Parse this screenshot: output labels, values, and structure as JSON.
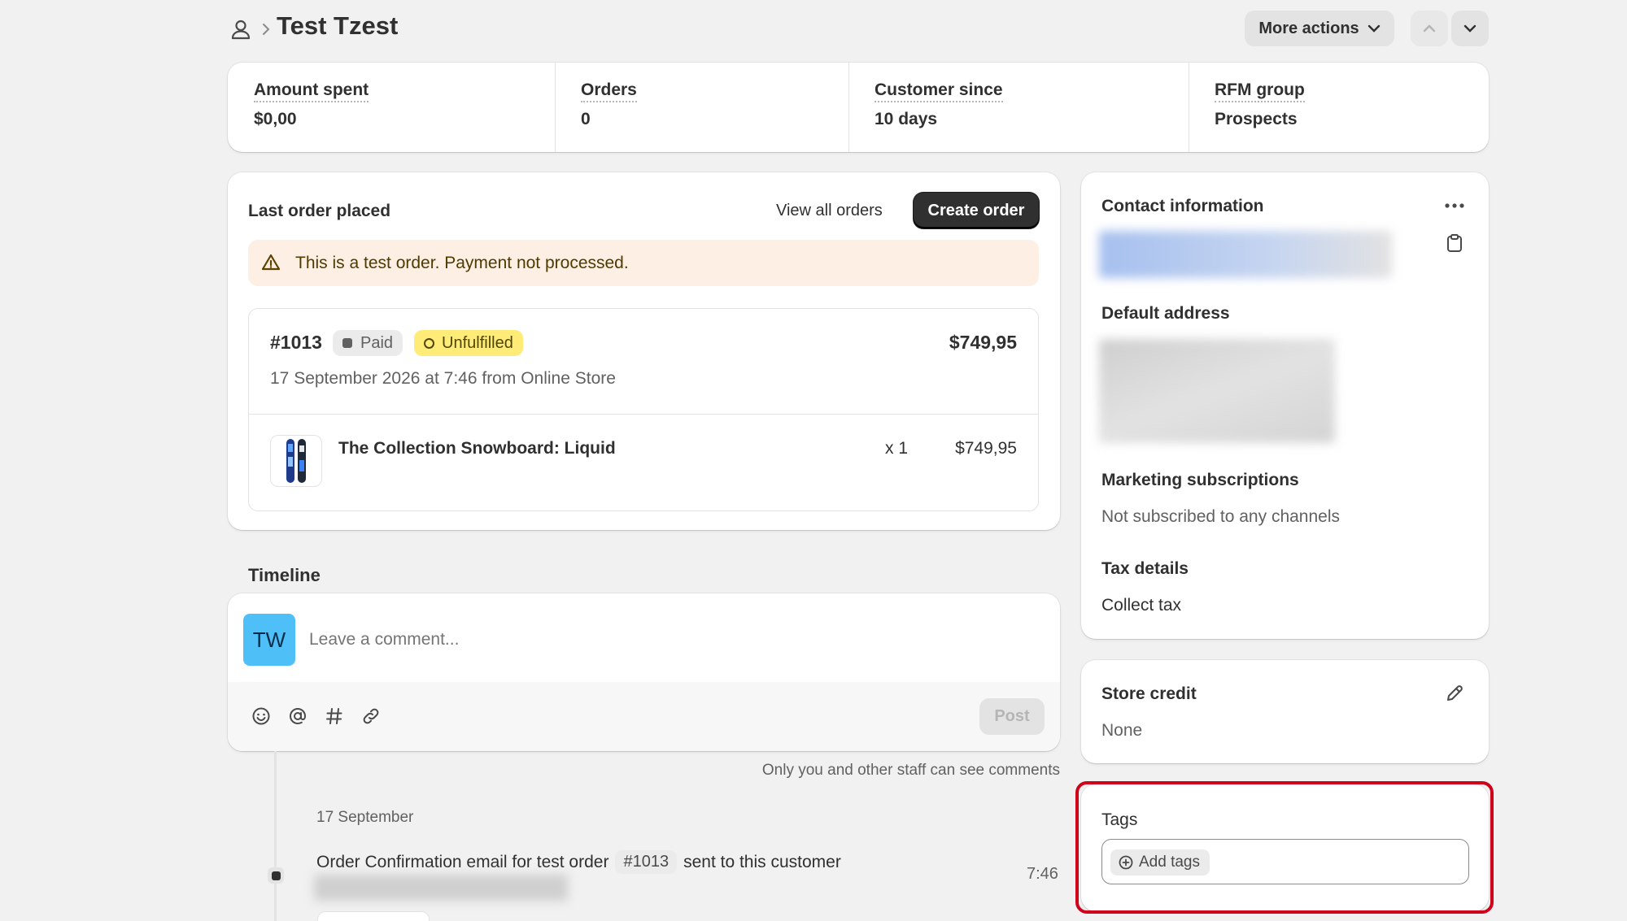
{
  "header": {
    "title": "Test Tzest",
    "more_actions": "More actions"
  },
  "stats": [
    {
      "label": "Amount spent",
      "value": "$0,00"
    },
    {
      "label": "Orders",
      "value": "0"
    },
    {
      "label": "Customer since",
      "value": "10 days"
    },
    {
      "label": "RFM group",
      "value": "Prospects"
    }
  ],
  "last_order": {
    "title": "Last order placed",
    "view_all": "View all orders",
    "create": "Create order",
    "warning": "This is a test order. Payment not processed.",
    "number": "#1013",
    "paid_badge": "Paid",
    "fulfillment_badge": "Unfulfilled",
    "total": "$749,95",
    "meta": "17 September 2026 at 7:46 from Online Store",
    "item_name": "The Collection Snowboard: Liquid",
    "item_qty": "x 1",
    "item_price": "$749,95"
  },
  "timeline": {
    "title": "Timeline",
    "avatar_initials": "TW",
    "placeholder": "Leave a comment...",
    "post": "Post",
    "staff_note": "Only you and other staff can see comments",
    "date": "17 September",
    "event_prefix": "Order Confirmation email for test order",
    "event_order_ref": "#1013",
    "event_suffix": "sent to this customer",
    "event_time": "7:46"
  },
  "contact": {
    "title": "Contact information",
    "default_address": "Default address",
    "marketing_title": "Marketing subscriptions",
    "marketing_value": "Not subscribed to any channels",
    "tax_title": "Tax details",
    "tax_value": "Collect tax"
  },
  "store_credit": {
    "title": "Store credit",
    "value": "None"
  },
  "tags": {
    "title": "Tags",
    "add": "Add tags"
  },
  "colors": {
    "highlight": "#d0021b",
    "warning_bg": "#fdefe3",
    "unfulfilled_bg": "#ffeb78",
    "avatar_bg": "#4fbff8",
    "primary_btn": "#303030"
  }
}
